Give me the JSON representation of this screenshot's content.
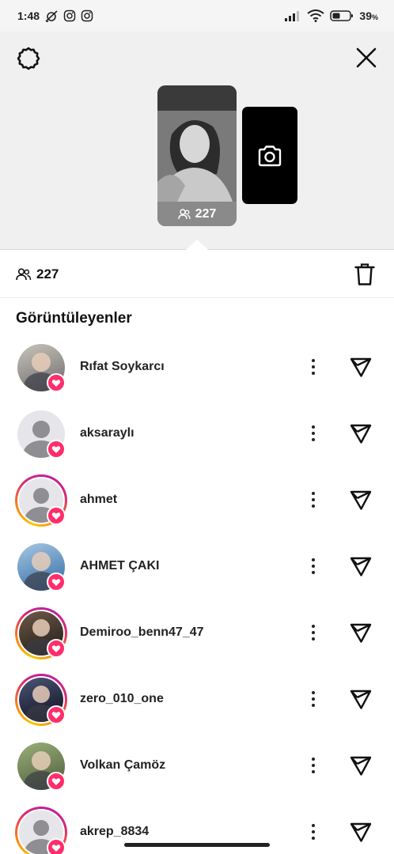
{
  "status_bar": {
    "time": "1:48",
    "battery": "39",
    "battery_unit": "%"
  },
  "story": {
    "viewer_count": "227"
  },
  "summary": {
    "viewer_count": "227"
  },
  "section_title": "Görüntüleyenler",
  "viewers": [
    {
      "name": "Rıfat Soykarcı",
      "avatar": "photo",
      "ring": false,
      "photo_colors": [
        "#c9c3bb",
        "#6b6a6c"
      ]
    },
    {
      "name": "aksaraylı",
      "avatar": "default",
      "ring": false
    },
    {
      "name": "ahmet",
      "avatar": "default",
      "ring": true
    },
    {
      "name": "AHMET ÇAKI",
      "avatar": "photo",
      "ring": false,
      "photo_colors": [
        "#a8c7e3",
        "#2e6aa3"
      ]
    },
    {
      "name": "Demiroo_benn47_47",
      "avatar": "photo",
      "ring": true,
      "photo_colors": [
        "#6d5a47",
        "#1f1a17"
      ]
    },
    {
      "name": "zero_010_one",
      "avatar": "photo",
      "ring": true,
      "photo_colors": [
        "#4c5677",
        "#0b0d1c"
      ]
    },
    {
      "name": "Volkan Çamöz",
      "avatar": "photo",
      "ring": false,
      "photo_colors": [
        "#9bb079",
        "#4b5a3a"
      ]
    },
    {
      "name": "akrep_8834",
      "avatar": "default",
      "ring": true
    }
  ]
}
